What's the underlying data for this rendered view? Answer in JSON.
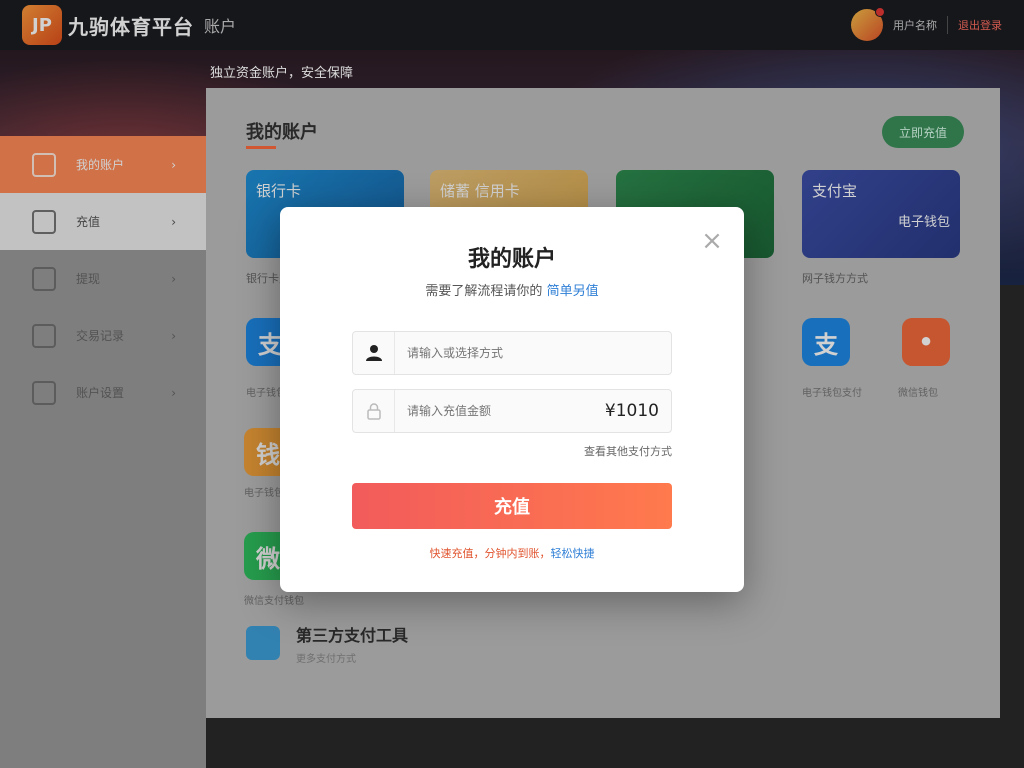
{
  "header": {
    "logo_mark": "JP",
    "brand": "九驹体育平台",
    "section": "账户",
    "user_name": "用户名称",
    "top_link": "退出登录"
  },
  "banner": {
    "text": "独立资金账户，安全保障"
  },
  "sidebar": {
    "items": [
      {
        "label": "我的账户",
        "arrow": "›"
      },
      {
        "label": "充值",
        "arrow": "›"
      },
      {
        "label": "提现",
        "arrow": "›"
      },
      {
        "label": "交易记录",
        "arrow": "›"
      },
      {
        "label": "账户设置",
        "arrow": "›"
      }
    ]
  },
  "main": {
    "title": "我的账户",
    "top_button": "立即充值",
    "cards": [
      {
        "label": "银行卡",
        "caption": "银行卡支付"
      },
      {
        "label": "储蓄 信用卡",
        "caption": ""
      },
      {
        "label": "",
        "caption": ""
      },
      {
        "label": "支付宝",
        "sublabel": "电子钱包",
        "caption": "网子钱方方式"
      }
    ],
    "pay_methods": [
      {
        "glyph": "支",
        "caption": "电子钱包",
        "color": "#1e88e5"
      },
      {
        "glyph": "支",
        "caption": "电子钱包支付",
        "color": "#1e88e5"
      },
      {
        "glyph": "•",
        "caption": "微信钱包",
        "color": "#f26a3b"
      },
      {
        "glyph": "钱",
        "caption": "电子钱包",
        "color": "#f0a03a"
      },
      {
        "glyph": "微",
        "caption": "微信支付钱包",
        "color": "#2fbf5f"
      }
    ],
    "third_party": {
      "title": "第三方支付工具",
      "subtitle": "更多支付方式"
    }
  },
  "modal": {
    "close_glyph": "×",
    "title": "我的账户",
    "subtitle_prefix": "需要了解流程请你的 ",
    "subtitle_link": "简单另值",
    "account_placeholder": "请输入或选择方式",
    "amount_placeholder": "请输入充值金额",
    "amount_value": "¥1010",
    "hint": "查看其他支付方式",
    "button": "充值",
    "footer_prefix": "快速充值，分钟内到账，",
    "footer_link": "轻松快捷"
  },
  "colors": {
    "accent": "#ff8a57",
    "button_start": "#f25b5b",
    "button_end": "#ff7a4d",
    "link": "#2f7fd6"
  }
}
